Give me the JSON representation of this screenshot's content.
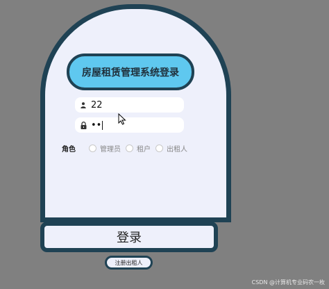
{
  "title": "房屋租赁管理系统登录",
  "username": {
    "value": "22",
    "icon": "user-icon"
  },
  "password": {
    "value": "••",
    "icon": "lock-icon"
  },
  "role": {
    "label": "角色",
    "options": [
      "管理员",
      "租户",
      "出租人"
    ]
  },
  "login_label": "登录",
  "register_label": "注册出租人",
  "watermark": "CSDN @计算机专业码农一枚",
  "colors": {
    "background": "#808080",
    "card": "#eef0fb",
    "border": "#1f4254",
    "accent": "#5fc8ef"
  }
}
